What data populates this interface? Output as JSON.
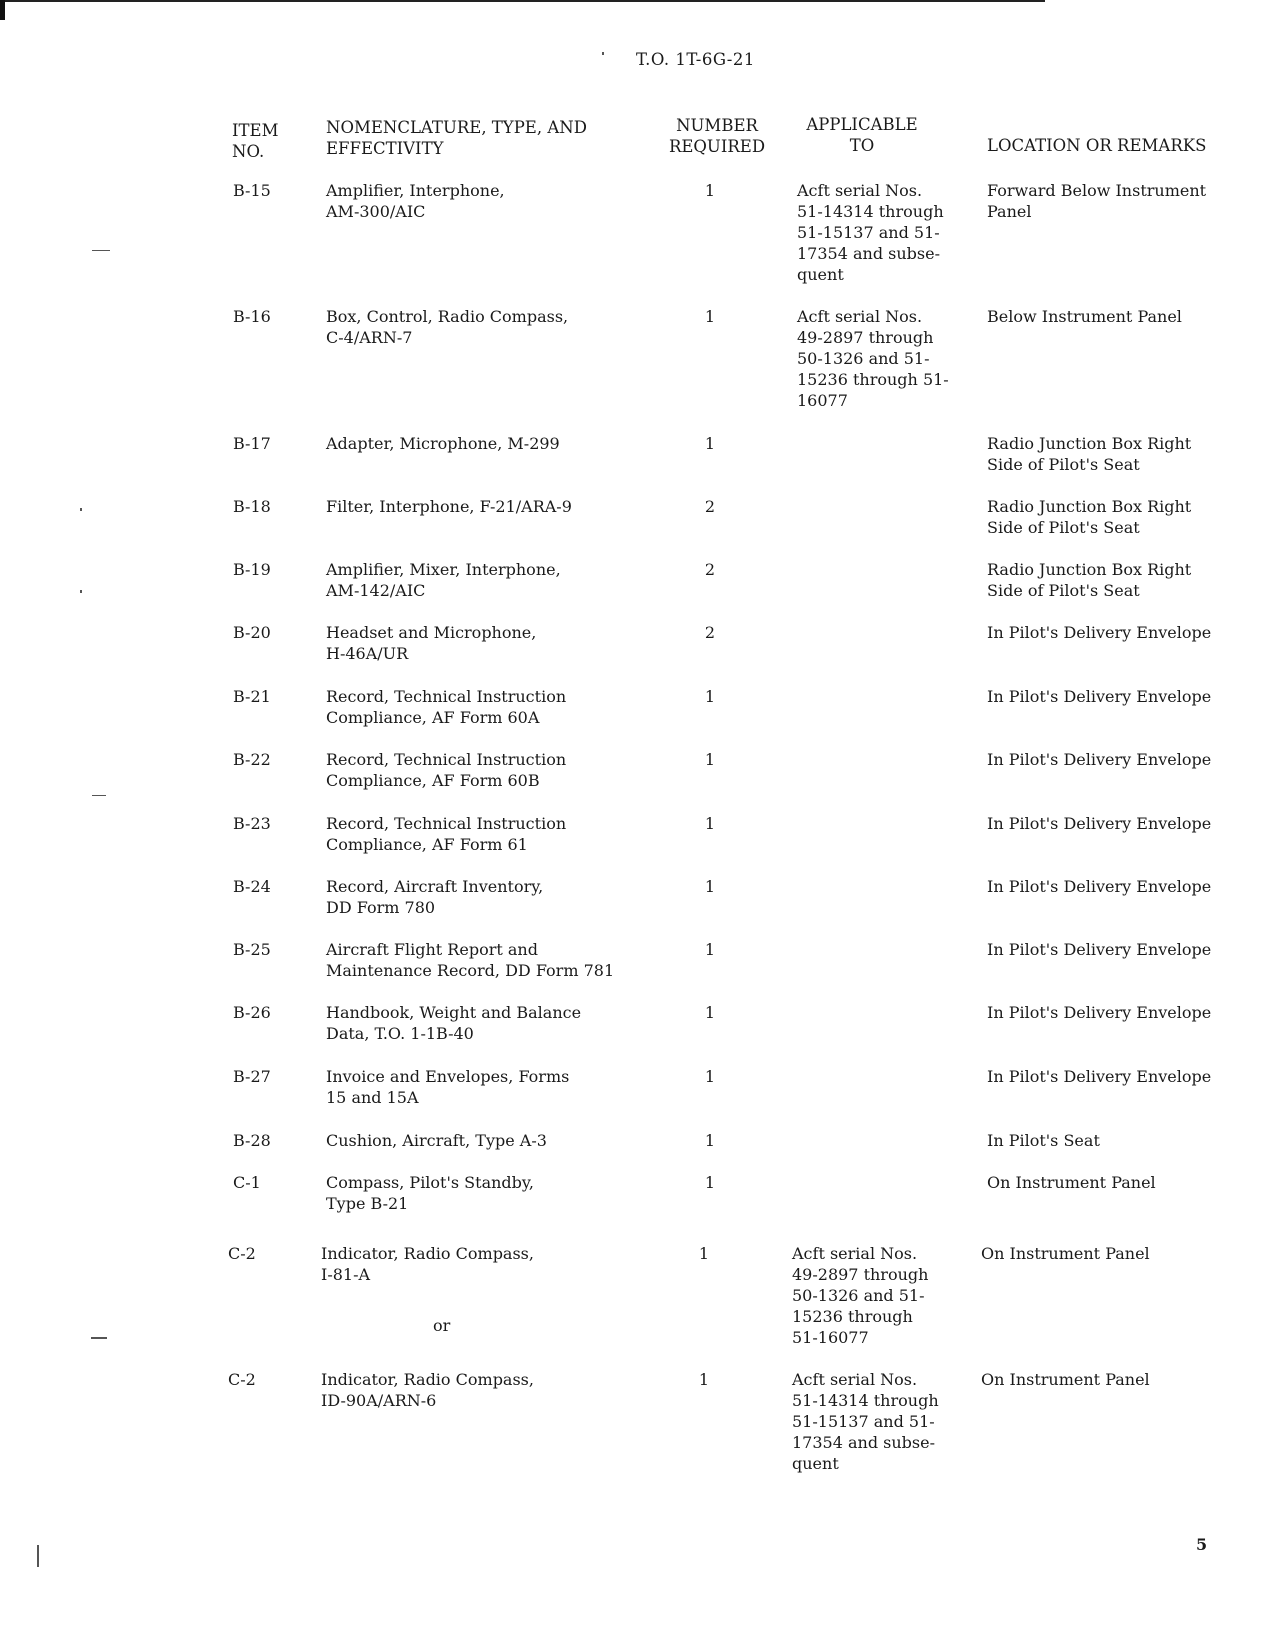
{
  "header": {
    "document_id": "T.O. 1T-6G-21"
  },
  "table": {
    "columns": {
      "item_no": "ITEM\nNO.",
      "nomenclature": "NOMENCLATURE, TYPE, AND\nEFFECTIVITY",
      "number_required": "NUMBER\nREQUIRED",
      "applicable_to": "APPLICABLE\nTO",
      "location": "LOCATION OR REMARKS"
    },
    "rows": [
      {
        "item": "B-15",
        "nomenclature": "Amplifier, Interphone,\nAM-300/AIC",
        "number": "1",
        "applicable": "Acft serial Nos.\n51-14314 through\n51-15137 and 51-\n17354 and subse-\nquent",
        "location": "Forward Below Instrument\nPanel"
      },
      {
        "item": "B-16",
        "nomenclature": "Box, Control, Radio Compass,\nC-4/ARN-7",
        "number": "1",
        "applicable": "Acft serial Nos.\n49-2897 through\n50-1326 and 51-\n15236 through 51-\n16077",
        "location": "Below Instrument Panel"
      },
      {
        "item": "B-17",
        "nomenclature": "Adapter, Microphone, M-299",
        "number": "1",
        "applicable": "",
        "location": "Radio Junction Box Right\nSide of Pilot's Seat"
      },
      {
        "item": "B-18",
        "nomenclature": "Filter, Interphone, F-21/ARA-9",
        "number": "2",
        "applicable": "",
        "location": "Radio Junction Box Right\nSide of Pilot's Seat"
      },
      {
        "item": "B-19",
        "nomenclature": "Amplifier, Mixer, Interphone,\nAM-142/AIC",
        "number": "2",
        "applicable": "",
        "location": "Radio Junction Box Right\nSide of Pilot's Seat"
      },
      {
        "item": "B-20",
        "nomenclature": "Headset and Microphone,\nH-46A/UR",
        "number": "2",
        "applicable": "",
        "location": "In Pilot's Delivery Envelope"
      },
      {
        "item": "B-21",
        "nomenclature": "Record, Technical Instruction\nCompliance, AF Form 60A",
        "number": "1",
        "applicable": "",
        "location": "In Pilot's Delivery Envelope"
      },
      {
        "item": "B-22",
        "nomenclature": "Record, Technical Instruction\nCompliance, AF Form 60B",
        "number": "1",
        "applicable": "",
        "location": "In Pilot's Delivery Envelope"
      },
      {
        "item": "B-23",
        "nomenclature": "Record, Technical Instruction\nCompliance, AF Form 61",
        "number": "1",
        "applicable": "",
        "location": "In Pilot's Delivery Envelope"
      },
      {
        "item": "B-24",
        "nomenclature": "Record, Aircraft Inventory,\nDD Form 780",
        "number": "1",
        "applicable": "",
        "location": "In Pilot's Delivery Envelope"
      },
      {
        "item": "B-25",
        "nomenclature": "Aircraft Flight Report and\nMaintenance Record, DD Form 781",
        "number": "1",
        "applicable": "",
        "location": "In Pilot's Delivery Envelope"
      },
      {
        "item": "B-26",
        "nomenclature": "Handbook, Weight and Balance\nData, T.O. 1-1B-40",
        "number": "1",
        "applicable": "",
        "location": "In Pilot's Delivery Envelope"
      },
      {
        "item": "B-27",
        "nomenclature": "Invoice and Envelopes, Forms\n15 and 15A",
        "number": "1",
        "applicable": "",
        "location": "In Pilot's Delivery Envelope"
      },
      {
        "item": "B-28",
        "nomenclature": "Cushion, Aircraft, Type A-3",
        "number": "1",
        "applicable": "",
        "location": "In Pilot's Seat"
      },
      {
        "item": "C-1",
        "nomenclature": "Compass, Pilot's Standby,\nType B-21",
        "number": "1",
        "applicable": "",
        "location": "On Instrument Panel"
      },
      {
        "item": "C-2",
        "nomenclature": "Indicator, Radio Compass,\nI-81-A",
        "number": "1",
        "applicable": "Acft serial Nos.\n49-2897 through\n50-1326 and 51-\n15236 through\n51-16077",
        "location": "On Instrument Panel"
      },
      {
        "item": "C-2",
        "nomenclature": "Indicator, Radio Compass,\nID-90A/ARN-6",
        "number": "1",
        "applicable": "Acft serial Nos.\n51-14314 through\n51-15137 and 51-\n17354 and subse-\nquent",
        "location": "On Instrument Panel"
      }
    ],
    "or_separator": "or"
  },
  "footer": {
    "page_number": "5"
  }
}
